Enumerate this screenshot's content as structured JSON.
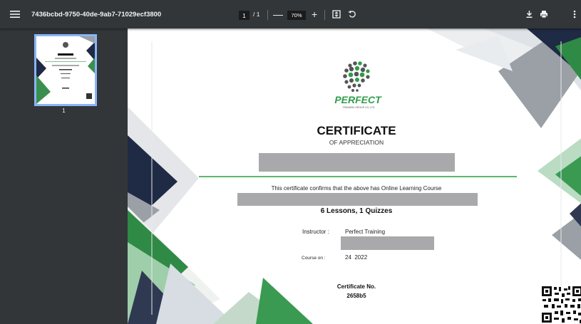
{
  "toolbar": {
    "title": "7436bcbd-9750-40de-9ab7-71029ecf3800",
    "page_current": "1",
    "page_total": "/ 1",
    "zoom_out": "—",
    "zoom": "70%",
    "zoom_in": "+",
    "icons": [
      "menu-icon",
      "fit-page-icon",
      "rotate-icon",
      "download-icon",
      "print-icon",
      "more-vert-icon"
    ]
  },
  "sidebar": {
    "thumbnail_label": "1"
  },
  "certificate": {
    "brand": "PERFECT",
    "brand_sub": "TRAINING GROUP CO.,LTD",
    "title": "CERTIFICATE",
    "subtitle": "OF APPRECIATION",
    "confirm_text": "This certificate confirms that the above has Online Learning Course",
    "lessons": "6 Lessons, 1 Quizzes",
    "instructor_label": "Instructor :",
    "instructor_value": "Perfect Training",
    "course_on_label": "Course on :",
    "course_on_value": "24  2022",
    "cert_no_label": "Certificate No.",
    "cert_no_value": "2658b5"
  },
  "colors": {
    "toolbar_bg": "#323639",
    "viewer_bg": "#525659",
    "thumb_border": "#8ab4f8",
    "brand_green": "#2e9e4a",
    "navy": "#1f2a44",
    "redaction": "#a9a9ac"
  }
}
